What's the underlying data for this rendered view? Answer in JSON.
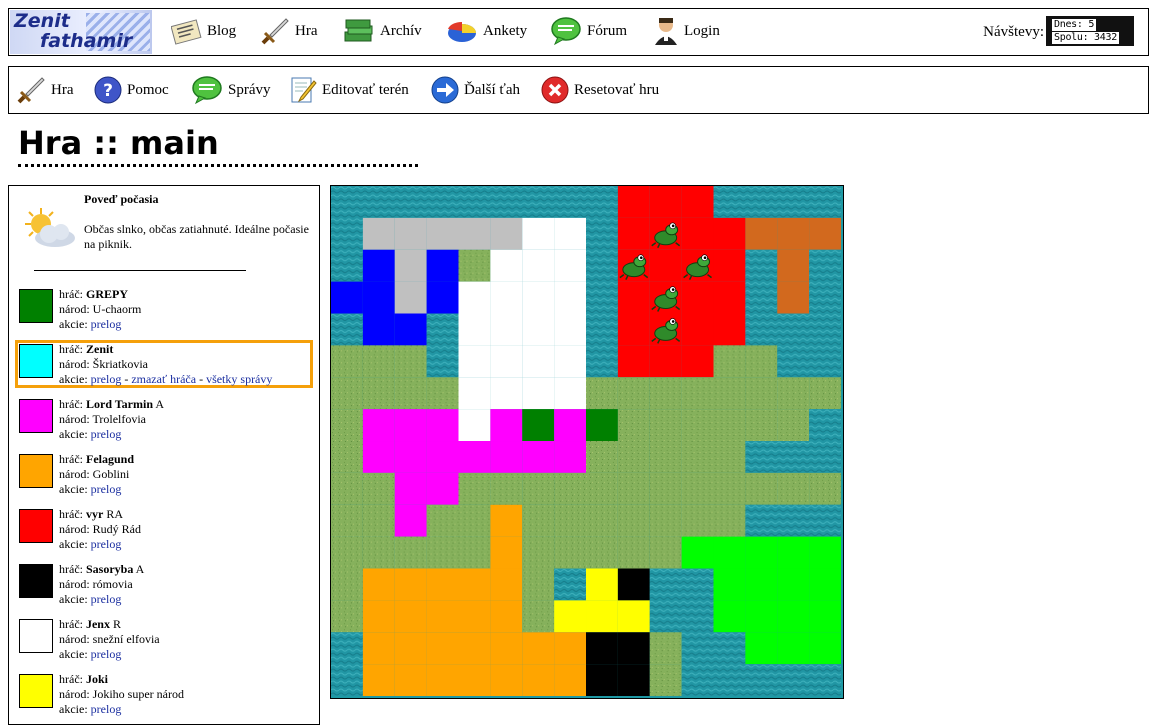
{
  "header": {
    "logo_text": [
      "Zenit",
      "fathamir"
    ],
    "nav": [
      {
        "label": "Blog",
        "icon": "newspaper-icon"
      },
      {
        "label": "Hra",
        "icon": "sword-icon"
      },
      {
        "label": "Archív",
        "icon": "archive-icon"
      },
      {
        "label": "Ankety",
        "icon": "pie-chart-icon"
      },
      {
        "label": "Fórum",
        "icon": "speech-bubble-icon"
      },
      {
        "label": "Login",
        "icon": "user-icon"
      }
    ],
    "visits_label": "Návštevy:",
    "counter": {
      "today": "Dnes: 5",
      "total": "Spolu: 3432"
    }
  },
  "toolbar": [
    {
      "label": "Hra",
      "icon": "sword-icon"
    },
    {
      "label": "Pomoc",
      "icon": "help-icon"
    },
    {
      "label": "Správy",
      "icon": "speech-bubble-icon"
    },
    {
      "label": "Editovať terén",
      "icon": "edit-pencil-icon"
    },
    {
      "label": "Ďalší ťah",
      "icon": "next-arrow-icon"
    },
    {
      "label": "Resetovať hru",
      "icon": "reset-x-icon"
    }
  ],
  "page_title": "Hra :: main",
  "weather": {
    "title": "Poveď počasia",
    "text": "Občas slnko, občas zatiahnuté. Ideálne počasie na piknik.",
    "icon": "sun-cloud-icon"
  },
  "labels": {
    "player": "hráč:",
    "nation": "národ:",
    "actions": "akcie:"
  },
  "players": [
    {
      "name": "GREPY",
      "badge": "",
      "nation": "U-chaorm",
      "color": "#008000",
      "actions": [
        "prelog"
      ]
    },
    {
      "name": "Zenit",
      "badge": "",
      "nation": "Škriatkovia",
      "color": "#00ffff",
      "actions": [
        "prelog",
        "zmazať hráča",
        "všetky správy"
      ],
      "selected": true
    },
    {
      "name": "Lord Tarmin",
      "badge": "A",
      "nation": "Trolelfovia",
      "color": "#ff00ff",
      "actions": [
        "prelog"
      ]
    },
    {
      "name": "Felagund",
      "badge": "",
      "nation": "Goblini",
      "color": "#ffa500",
      "actions": [
        "prelog"
      ]
    },
    {
      "name": "vyr",
      "badge": "RA",
      "nation": "Rudý Rád",
      "color": "#ff0000",
      "actions": [
        "prelog"
      ]
    },
    {
      "name": "Sasoryba",
      "badge": "A",
      "nation": "rómovia",
      "color": "#000000",
      "actions": [
        "prelog"
      ]
    },
    {
      "name": "Jenx",
      "badge": "R",
      "nation": "snežní elfovia",
      "color": "#ffffff",
      "actions": [
        "prelog"
      ]
    },
    {
      "name": "Joki",
      "badge": "",
      "nation": "Jokiho super národ",
      "color": "#ffff00",
      "actions": [
        "prelog"
      ]
    }
  ],
  "map": {
    "legend": {
      "w": "#1f9aa5",
      "l": "#87b45a",
      "G": "#c0c0c0",
      "W": "#ffffff",
      "B": "#0000ff",
      "R": "#ff0000",
      "O": "#d2691e",
      "C": "#00ffff",
      "M": "#ff00ff",
      "g": "#008000",
      "L": "#00ff00",
      "A": "#ffa500",
      "Y": "#ffff00",
      "K": "#000000"
    },
    "rows": [
      "wwwwwwwwwRRRwwww",
      "wGGGGGWWwRRRROOO",
      "wBGBlWWWwRRRRwOw",
      "BBGBWWWWwRRRRwOw",
      "wBBwWWWWwRRRRwww",
      "lllwWWWWwRRRllww",
      "llllWWWWllllllll",
      "lMMMWMgMgllllllw",
      "lMMMMMMMlllllwww",
      "llMMllllllllllll",
      "llMllAlllllllwww",
      "lllllAlllllLLLLL",
      "lAAAAAlwYKwwLLLL",
      "lAAAAAlYYYwwLLLL",
      "wAAAAAAAKKlwwLLL",
      "wAAAAAAAKKlwwwww"
    ],
    "units": [
      [
        10,
        1
      ],
      [
        9,
        2
      ],
      [
        11,
        2
      ],
      [
        10,
        3
      ],
      [
        10,
        4
      ]
    ],
    "unit_icon": "frog-icon"
  }
}
